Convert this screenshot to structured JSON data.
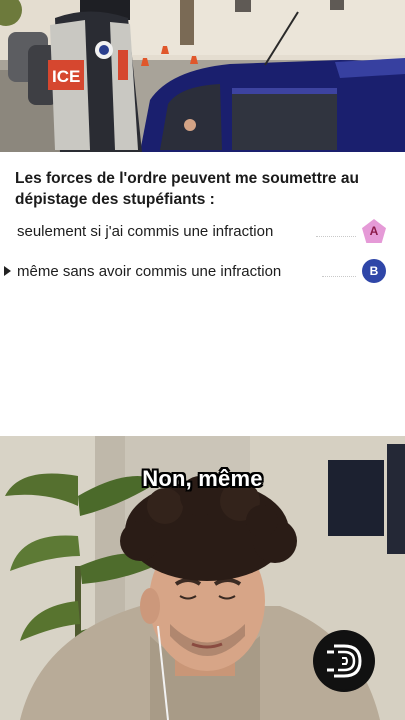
{
  "quiz": {
    "question": "Les forces de l'ordre peuvent me soumettre au dépistage des stupéfiants :",
    "answers": [
      {
        "letter": "A",
        "text": "seulement si j'ai commis une infraction",
        "selected": false,
        "color": "#e59ad7"
      },
      {
        "letter": "B",
        "text": "même sans avoir commis une infraction",
        "selected": true,
        "color": "#2f46a8"
      }
    ]
  },
  "top_photo": {
    "vest_text": "ICE"
  },
  "video": {
    "caption": "Non, même"
  },
  "colors": {
    "car": "#1a1f6e",
    "hoodie": "#b8ab98",
    "badge_a": "#e59ad7",
    "badge_b": "#2f46a8"
  }
}
